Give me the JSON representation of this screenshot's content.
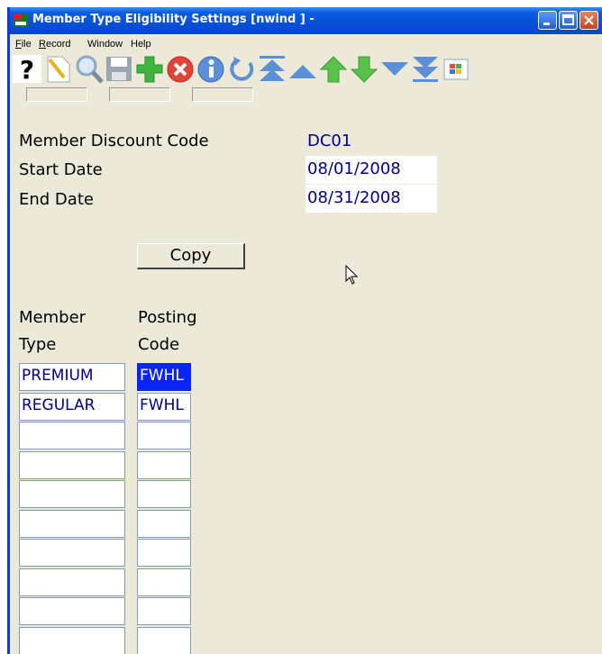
{
  "window": {
    "title": "Member Type Eligibility Settings [nwind  ] -",
    "accent": "#0a5ce0"
  },
  "menu": [
    {
      "label": "File",
      "mnemonic": "F"
    },
    {
      "label": "Record",
      "mnemonic": "R"
    },
    {
      "label": "Window",
      "mnemonic": ""
    },
    {
      "label": "Help",
      "mnemonic": ""
    }
  ],
  "toolbar": [
    "help-icon",
    "new-record-icon",
    "search-icon",
    "save-icon",
    "add-icon",
    "delete-icon",
    "info-icon",
    "refresh-icon",
    "first-record-icon",
    "previous-page-icon",
    "previous-record-icon",
    "next-record-icon",
    "next-page-icon",
    "last-record-icon",
    "windows-icon"
  ],
  "form": {
    "discount_code_label": "Member Discount Code",
    "discount_code_value": "DC01",
    "start_date_label": "Start Date",
    "start_date_value": "08/01/2008",
    "end_date_label": "End Date",
    "end_date_value": "08/31/2008",
    "copy_label": "Copy"
  },
  "grid": {
    "col1_header": [
      "Member",
      "Type"
    ],
    "col2_header": [
      "Posting",
      "Code"
    ],
    "rows": [
      {
        "member_type": "PREMIUM",
        "posting_code": "FWHL",
        "selected_code": true
      },
      {
        "member_type": "REGULAR",
        "posting_code": "FWHL",
        "selected_code": false
      },
      {
        "member_type": "",
        "posting_code": ""
      },
      {
        "member_type": "",
        "posting_code": ""
      },
      {
        "member_type": "",
        "posting_code": ""
      },
      {
        "member_type": "",
        "posting_code": ""
      },
      {
        "member_type": "",
        "posting_code": ""
      },
      {
        "member_type": "",
        "posting_code": ""
      },
      {
        "member_type": "",
        "posting_code": ""
      },
      {
        "member_type": "",
        "posting_code": ""
      }
    ]
  }
}
